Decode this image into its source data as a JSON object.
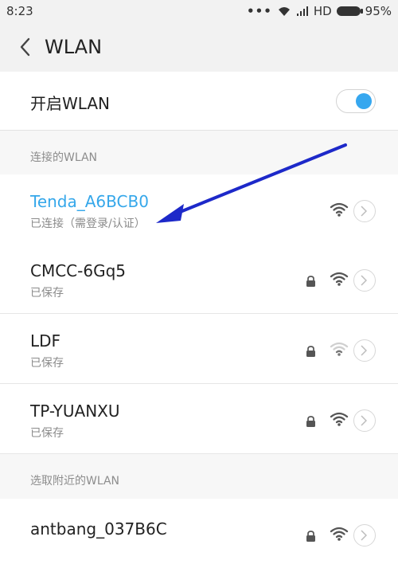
{
  "status_bar": {
    "time": "8:23",
    "network": "HD",
    "battery": "95%"
  },
  "header": {
    "title": "WLAN"
  },
  "toggle": {
    "label": "开启WLAN",
    "state": "on",
    "accent": "#36a7ef"
  },
  "connected_section": {
    "label": "连接的WLAN",
    "items": [
      {
        "ssid": "Tenda_A6BCB0",
        "status": "已连接（需登录/认证）",
        "secured": false,
        "signal": "strong",
        "active": true
      }
    ]
  },
  "saved_networks": [
    {
      "ssid": "CMCC-6Gq5",
      "status": "已保存",
      "secured": true,
      "signal": "strong"
    },
    {
      "ssid": "LDF",
      "status": "已保存",
      "secured": true,
      "signal": "weak"
    },
    {
      "ssid": "TP-YUANXU",
      "status": "已保存",
      "secured": true,
      "signal": "strong"
    }
  ],
  "nearby_section": {
    "label": "选取附近的WLAN",
    "items": [
      {
        "ssid": "antbang_037B6C",
        "secured": true,
        "signal": "strong"
      }
    ]
  },
  "annotation_color": "#1d29c9"
}
